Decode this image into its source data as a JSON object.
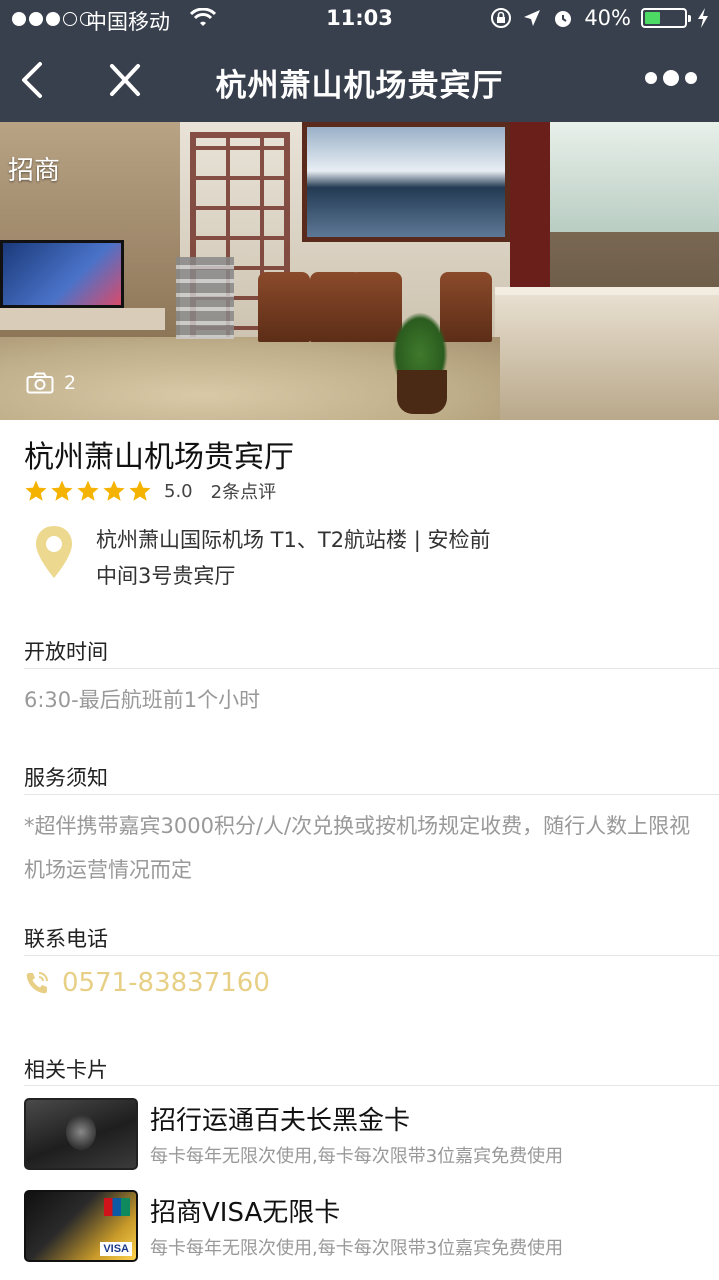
{
  "status_bar": {
    "carrier": "中国移动",
    "time": "11:03",
    "battery": "40%",
    "battery_level": 0.4
  },
  "nav": {
    "title": "杭州萧山机场贵宾厅",
    "icons": [
      "back-icon",
      "close-icon",
      "more-icon"
    ]
  },
  "hero": {
    "tag": "招商",
    "photo_count": "2"
  },
  "lounge": {
    "name": "杭州萧山机场贵宾厅",
    "stars": 5,
    "score": "5.0",
    "reviews": "2条点评",
    "address_line1": "杭州萧山国际机场 T1、T2航站楼 | 安检前",
    "address_line2": "中间3号贵宾厅"
  },
  "sections": {
    "hours_title": "开放时间",
    "hours": "6:30-最后航班前1个小时",
    "notice_title": "服务须知",
    "notice": "*超伴携带嘉宾3000积分/人/次兑换或按机场规定收费，随行人数上限视机场运营情况而定",
    "phone_title": "联系电话",
    "phone": "0571-83837160",
    "cards_title": "相关卡片"
  },
  "cards": [
    {
      "title": "招行运通百夫长黑金卡",
      "desc": "每卡每年无限次使用,每卡每次限带3位嘉宾免费使用"
    },
    {
      "title": "招商VISA无限卡",
      "desc": "每卡每年无限次使用,每卡每次限带3位嘉宾免费使用",
      "badge": "VISA"
    }
  ],
  "colors": {
    "nav_bg": "#39404d",
    "star": "#f5b301",
    "phone": "#e7cf86",
    "pin": "#ecd98f"
  }
}
